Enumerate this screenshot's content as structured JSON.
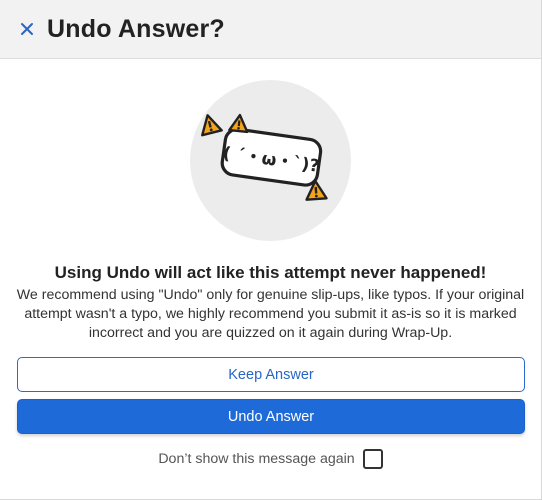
{
  "dialog": {
    "title": "Undo Answer?",
    "close_icon": "close-icon"
  },
  "illustration": {
    "kaomoji": "( ´・ω・`)?",
    "icons": [
      "warning-icon",
      "warning-icon",
      "warning-icon"
    ]
  },
  "content": {
    "headline": "Using Undo will act like this attempt never happened!",
    "body": "We recommend using \"Undo\" only for genuine slip-ups, like typos. If your original attempt wasn't a typo, we highly recommend you submit it as-is so it is marked incorrect and you are quizzed on it again during Wrap-Up."
  },
  "buttons": {
    "keep_label": "Keep Answer",
    "undo_label": "Undo Answer"
  },
  "preference": {
    "dont_show_label": "Don’t show this message again",
    "checked": false
  },
  "colors": {
    "primary": "#1e6ad9",
    "primary_text": "#2766c8",
    "header_bg": "#f2f2f2",
    "warning": "#f4a41c"
  }
}
